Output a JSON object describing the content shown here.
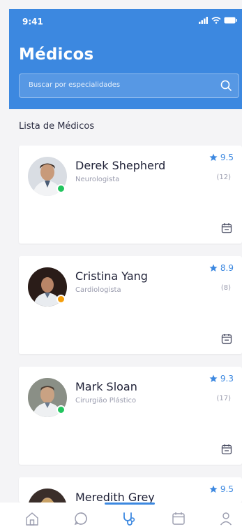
{
  "status": {
    "time": "9:41"
  },
  "header": {
    "title": "Médicos",
    "search_placeholder": "Buscar por especialidades"
  },
  "section_title": "Lista de Médicos",
  "doctors": [
    {
      "name": "Derek Shepherd",
      "specialty": "Neurologista",
      "rating": "9.5",
      "reviews": "(12)",
      "status_color": "#22c55e"
    },
    {
      "name": "Cristina Yang",
      "specialty": "Cardiologista",
      "rating": "8.9",
      "reviews": "(8)",
      "status_color": "#f59e0b"
    },
    {
      "name": "Mark Sloan",
      "specialty": "Cirurgião Plástico",
      "rating": "9.3",
      "reviews": "(17)",
      "status_color": "#22c55e"
    },
    {
      "name": "Meredith Grey",
      "rating": "9.5"
    }
  ],
  "tabs": [
    {
      "icon": "home-icon"
    },
    {
      "icon": "chat-icon"
    },
    {
      "icon": "stethoscope-icon",
      "active": true
    },
    {
      "icon": "calendar-icon"
    },
    {
      "icon": "profile-icon"
    }
  ],
  "colors": {
    "primary": "#3c88e0",
    "online": "#22c55e",
    "away": "#f59e0b"
  }
}
